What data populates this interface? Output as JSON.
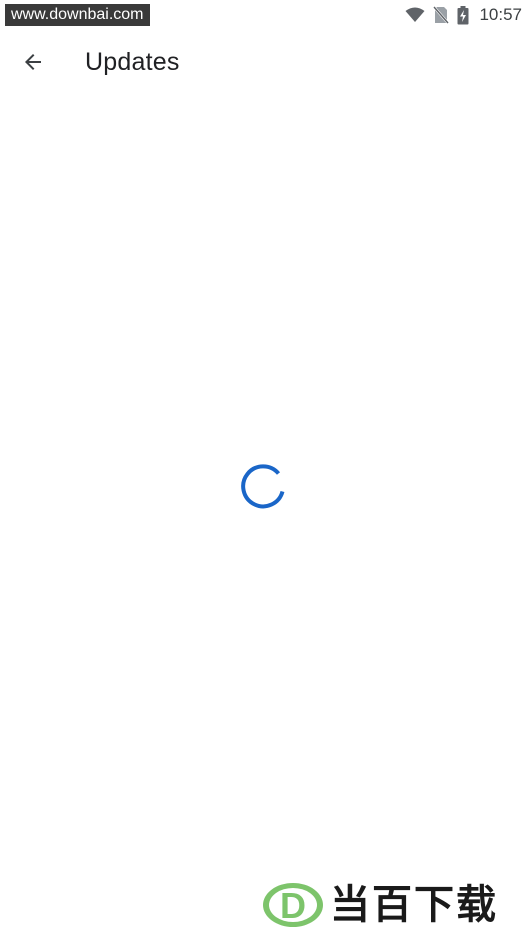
{
  "watermark": {
    "site": "www.downbai.com",
    "brand": "当百下载",
    "logo_letter": "D"
  },
  "status_bar": {
    "time": "10:57",
    "icons": [
      "wifi-icon",
      "no-sim-icon",
      "battery-charging-icon"
    ]
  },
  "app_bar": {
    "back_icon": "arrow-back-icon",
    "title": "Updates"
  },
  "content": {
    "state": "loading",
    "spinner_color": "#1a66c8"
  },
  "colors": {
    "background": "#ffffff",
    "title": "#202124",
    "accent": "#1a66c8",
    "logo_green": "#7dc46b"
  }
}
